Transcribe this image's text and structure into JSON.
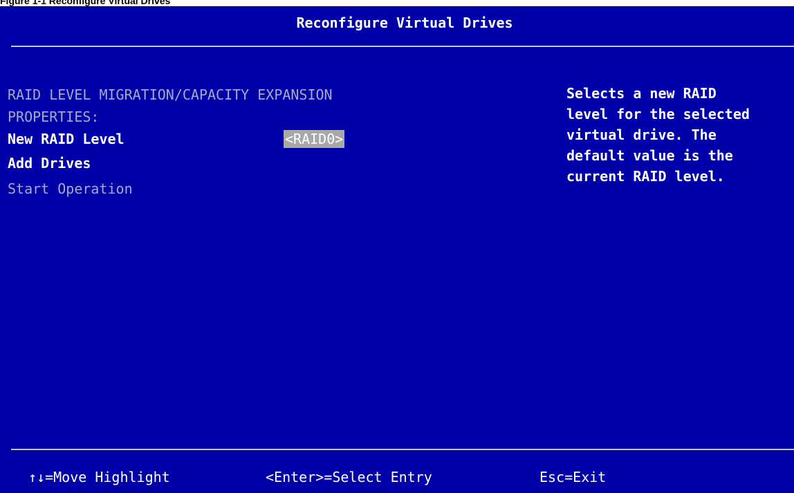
{
  "caption": "Figure 1-1 Reconfigure Virtual Drives",
  "header": {
    "title": "Reconfigure Virtual Drives"
  },
  "main": {
    "section_line1": "RAID LEVEL MIGRATION/CAPACITY EXPANSION",
    "section_line2": "PROPERTIES:",
    "items": [
      {
        "label": "New RAID Level",
        "value": "<RAID0>"
      },
      {
        "label": "Add Drives"
      },
      {
        "label": "Start Operation"
      }
    ]
  },
  "help": {
    "lines": [
      "Selects a new RAID",
      "level for the selected",
      "virtual drive. The",
      "default value is the",
      "current RAID level."
    ]
  },
  "footer": {
    "move": "↑↓=Move Highlight",
    "select": "<Enter>=Select Entry",
    "exit": "Esc=Exit"
  },
  "colors": {
    "background": "#0000a8",
    "text": "#ffffff",
    "dim_text": "#a8a8c8",
    "highlight": "#a8a8a8"
  }
}
